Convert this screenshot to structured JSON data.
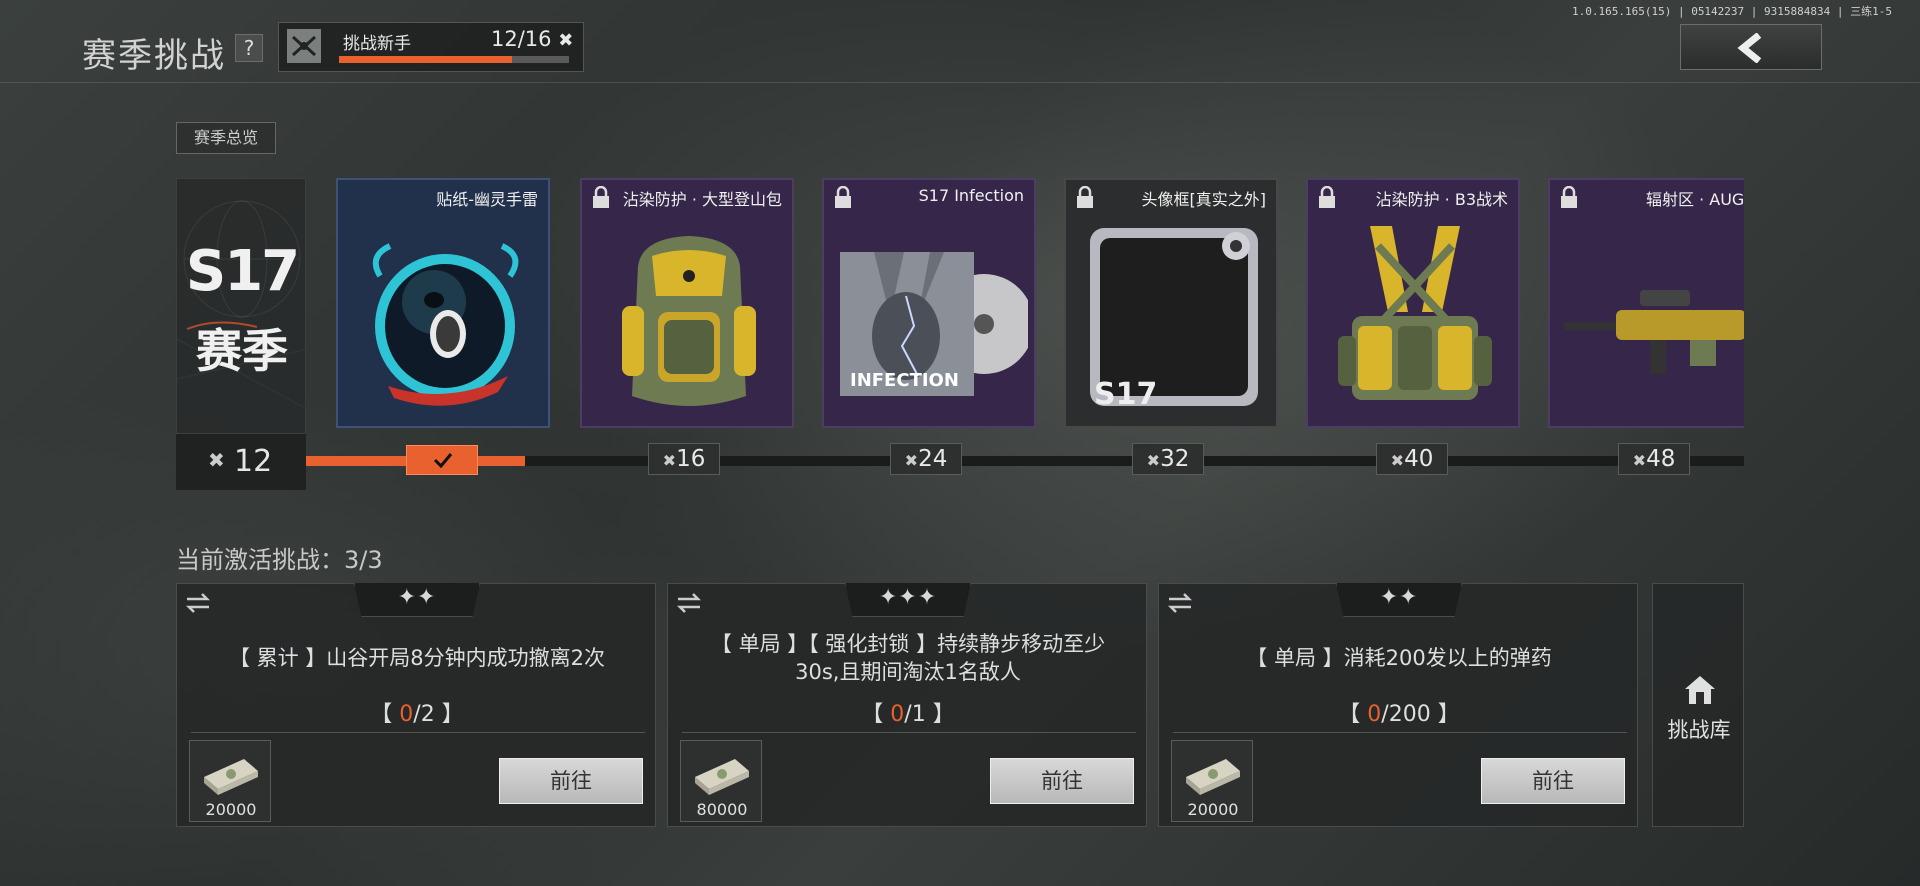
{
  "version": "1.0.165.165(15) | 05142237 | 9315884834 | 三练1-5",
  "header": {
    "title": "赛季挑战",
    "help": "?",
    "rank_name": "挑战新手",
    "rank_progress": "12/16",
    "rank_fraction": 0.75
  },
  "overview_tag": "赛季总览",
  "season": {
    "code": "S17",
    "label": "赛季",
    "count": "12"
  },
  "rewards": [
    {
      "name": "贴纸-幽灵手雷",
      "tier": "16",
      "locked": false
    },
    {
      "name": "沾染防护 · 大型登山包",
      "tier": "16",
      "locked": true
    },
    {
      "name": "S17 Infection",
      "tier": "24",
      "locked": true
    },
    {
      "name": "头像框[真实之外]",
      "tier": "32",
      "locked": true
    },
    {
      "name": "沾染防护 · B3战术",
      "tier": "40",
      "locked": true
    },
    {
      "name": "辐射区 · AUG",
      "tier": "48",
      "locked": true
    }
  ],
  "track_fill_fraction": 0.152,
  "milestones": [
    "16",
    "24",
    "32",
    "40",
    "48"
  ],
  "active_label": "当前激活挑战：3/3",
  "challenges": [
    {
      "stars": "✦✦",
      "desc": "【 累计 】山谷开局8分钟内成功撤离2次",
      "progress_open": "【 ",
      "progress_cur": "0",
      "progress_rest": "/2 】",
      "cash": "20000",
      "go": "前往"
    },
    {
      "stars": "✦✦✦",
      "desc": "【 单局 】【 强化封锁 】持续静步移动至少30s,且期间淘汰1名敌人",
      "progress_open": "【 ",
      "progress_cur": "0",
      "progress_rest": "/1 】",
      "cash": "80000",
      "go": "前往"
    },
    {
      "stars": "✦✦",
      "desc": "【 单局 】消耗200发以上的弹药",
      "progress_open": "【 ",
      "progress_cur": "0",
      "progress_rest": "/200 】",
      "cash": "20000",
      "go": "前往"
    }
  ],
  "library_label": "挑战库",
  "colors": {
    "accent": "#e8612e",
    "rare_blue": "#21304b",
    "epic_purple": "#36274a"
  }
}
